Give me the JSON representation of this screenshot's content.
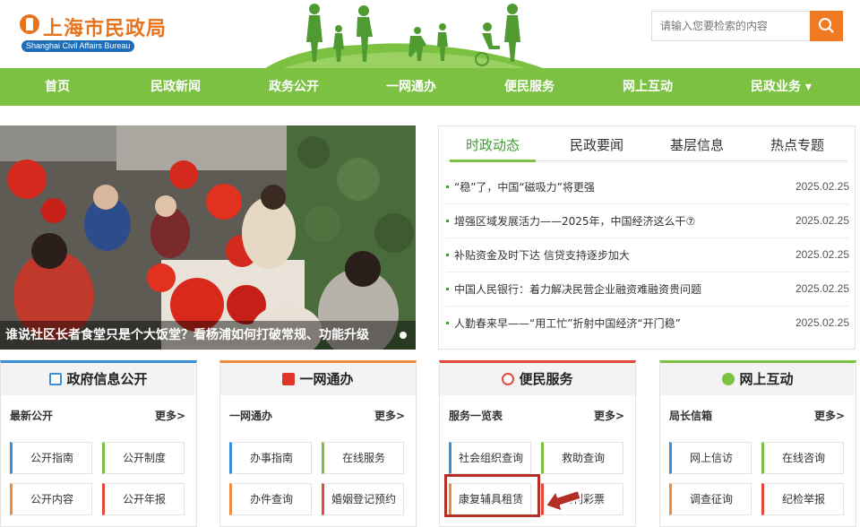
{
  "header": {
    "logo_cn": "上海市民政局",
    "logo_en": "Shanghai Civil Affairs Bureau",
    "search_placeholder": "请输入您要检索的内容"
  },
  "nav": [
    "首页",
    "民政新闻",
    "政务公开",
    "一网通办",
    "便民服务",
    "网上互动",
    "民政业务 ▾"
  ],
  "photo": {
    "caption": "谁说社区长者食堂只是个大饭堂？看杨浦如何打破常规、功能升级"
  },
  "news": {
    "tabs": [
      "时政动态",
      "民政要闻",
      "基层信息",
      "热点专题"
    ],
    "items": [
      {
        "title": "“稳”了，中国“磁吸力”将更强",
        "date": "2025.02.25"
      },
      {
        "title": "增强区域发展活力——2025年，中国经济这么干⑦",
        "date": "2025.02.25"
      },
      {
        "title": "补贴资金及时下达 信贷支持逐步加大",
        "date": "2025.02.25"
      },
      {
        "title": "中国人民银行：着力解决民营企业融资难融资贵问题",
        "date": "2025.02.25"
      },
      {
        "title": "人勤春来早——“用工忙”折射中国经济“开门稳”",
        "date": "2025.02.25"
      }
    ]
  },
  "panels": [
    {
      "title": "政府信息公开",
      "sub": "最新公开",
      "more": "更多>",
      "buttons": [
        "公开指南",
        "公开制度",
        "公开内容",
        "公开年报"
      ]
    },
    {
      "title": "一网通办",
      "sub": "一网通办",
      "more": "更多>",
      "buttons": [
        "办事指南",
        "在线服务",
        "办件查询",
        "婚姻登记预约"
      ]
    },
    {
      "title": "便民服务",
      "sub": "服务一览表",
      "more": "更多>",
      "buttons": [
        "社会组织查询",
        "救助查询",
        "康复辅具租赁",
        "福利彩票"
      ]
    },
    {
      "title": "网上互动",
      "sub": "局长信箱",
      "more": "更多>",
      "buttons": [
        "网上信访",
        "在线咨询",
        "调查征询",
        "纪检举报"
      ]
    }
  ],
  "colors": {
    "nav_green": "#7cc142",
    "brand_orange": "#e8731d",
    "highlight_red": "#b42f26"
  }
}
